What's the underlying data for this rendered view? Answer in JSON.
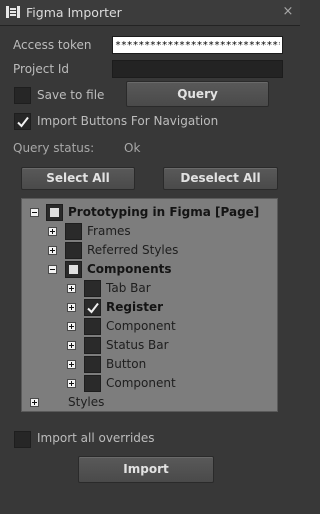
{
  "window": {
    "title": "Figma Importer",
    "close_glyph": "×"
  },
  "form": {
    "access_token_label": "Access token",
    "access_token_value": "****************************************",
    "project_id_label": "Project Id",
    "project_id_value": "",
    "save_to_file_label": "Save to file",
    "save_to_file_checked": false,
    "query_button": "Query",
    "import_buttons_label": "Import Buttons For Navigation",
    "import_buttons_checked": true,
    "query_status_label": "Query status:",
    "query_status_value": "Ok"
  },
  "selection": {
    "select_all": "Select All",
    "deselect_all": "Deselect All"
  },
  "tree": {
    "items": [
      {
        "label": "Prototyping in Figma [Page]",
        "bold": true,
        "toggle": "minus",
        "check": "partial"
      },
      {
        "label": "Frames",
        "bold": false,
        "toggle": "plus",
        "check": "none"
      },
      {
        "label": "Referred Styles",
        "bold": false,
        "toggle": "plus",
        "check": "none"
      },
      {
        "label": "Components",
        "bold": true,
        "toggle": "minus",
        "check": "partial"
      },
      {
        "label": "Tab Bar",
        "bold": false,
        "toggle": "plus",
        "check": "none"
      },
      {
        "label": "Register",
        "bold": true,
        "toggle": "plus",
        "check": "checked"
      },
      {
        "label": "Component",
        "bold": false,
        "toggle": "plus",
        "check": "none"
      },
      {
        "label": "Status Bar",
        "bold": false,
        "toggle": "plus",
        "check": "none"
      },
      {
        "label": "Button",
        "bold": false,
        "toggle": "plus",
        "check": "none"
      },
      {
        "label": "Component",
        "bold": false,
        "toggle": "plus",
        "check": "none"
      },
      {
        "label": "Styles",
        "bold": false,
        "toggle": "plus",
        "check": "hidden"
      }
    ]
  },
  "footer": {
    "import_all_overrides_label": "Import all overrides",
    "import_all_overrides_checked": false,
    "import_button": "Import"
  },
  "colors": {
    "background": "#383838",
    "tree_background": "#7d7d7d",
    "text": "#c8c8c8",
    "button": "#505050"
  }
}
